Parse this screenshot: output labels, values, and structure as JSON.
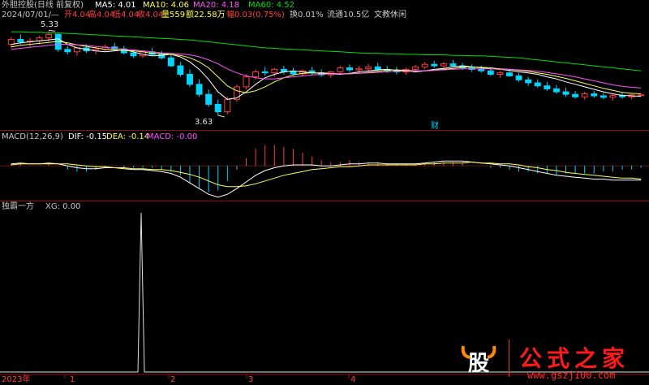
{
  "header": {
    "title": "外胆控股(日线 前复权)",
    "ma5_label": "MA5: 4.01",
    "ma10_label": "MA10: 4.06",
    "ma20_label": "MA20: 4.18",
    "ma60_label": "MA60: 4.52",
    "date": "2024/07/01/—",
    "open": "开4.04",
    "high": "高4.04",
    "low": "低4.04",
    "close": "收4.04",
    "volume": "量559",
    "amount": "额22.58万",
    "change": "幅0.03(0.75%)",
    "turnover": "换0.01%",
    "float": "流通10.5亿",
    "industry": "文教休闲"
  },
  "price_annotations": {
    "high": "5.33",
    "low": "3.63",
    "marker": "财"
  },
  "macd_header": {
    "name": "MACD(12,26,9)",
    "dif": "DIF: -0.15",
    "dea": "DEA: -0.14",
    "macd": "MACD: -0.00"
  },
  "xg_header": {
    "name": "独霸一方",
    "xg": "XG: 0.00"
  },
  "x_axis": {
    "labels": [
      "2023年",
      "1",
      "2",
      "3",
      "4"
    ]
  },
  "watermark": {
    "brand": "公式之家",
    "url": "www.gszj100.com",
    "logo_char": "股"
  },
  "colors": {
    "up": "#ff3c3c",
    "down": "#00d4ff",
    "ma5": "#ffffff",
    "ma10": "#ffff54",
    "ma20": "#ff54ff",
    "ma60": "#00e000",
    "dif": "#ffffff",
    "dea": "#ffff54"
  },
  "chart_data": [
    {
      "type": "candlestick",
      "title": "外胆控股(日线 前复权)",
      "ylim": [
        3.5,
        5.45
      ],
      "annotations": [
        {
          "label": "5.33",
          "value": 5.33
        },
        {
          "label": "3.63",
          "value": 3.63
        }
      ],
      "series": [
        {
          "name": "MA5",
          "values": [
            5.05,
            5.08,
            5.1,
            5.12,
            5.14,
            5.16,
            5.05,
            4.98,
            4.95,
            4.92,
            4.9,
            4.92,
            4.94,
            4.9,
            4.85,
            4.82,
            4.83,
            4.85,
            4.8,
            4.7,
            4.55,
            4.35,
            4.1,
            3.95,
            3.98,
            4.1,
            4.25,
            4.38,
            4.45,
            4.5,
            4.52,
            4.5,
            4.48,
            4.47,
            4.46,
            4.45,
            4.47,
            4.5,
            4.52,
            4.54,
            4.55,
            4.53,
            4.52,
            4.5,
            4.52,
            4.55,
            4.57,
            4.6,
            4.62,
            4.6,
            4.58,
            4.56,
            4.55,
            4.53,
            4.5,
            4.48,
            4.45,
            4.4,
            4.36,
            4.3,
            4.25,
            4.2,
            4.15,
            4.1,
            4.06,
            4.03,
            4.02,
            4.01
          ]
        },
        {
          "name": "MA10",
          "values": [
            5.0,
            5.03,
            5.05,
            5.07,
            5.09,
            5.11,
            5.08,
            5.04,
            5.01,
            4.98,
            4.95,
            4.94,
            4.93,
            4.92,
            4.9,
            4.87,
            4.86,
            4.85,
            4.83,
            4.78,
            4.7,
            4.58,
            4.4,
            4.22,
            4.12,
            4.08,
            4.12,
            4.2,
            4.3,
            4.38,
            4.44,
            4.47,
            4.48,
            4.48,
            4.47,
            4.46,
            4.46,
            4.47,
            4.49,
            4.51,
            4.53,
            4.54,
            4.53,
            4.52,
            4.52,
            4.53,
            4.55,
            4.57,
            4.59,
            4.6,
            4.59,
            4.58,
            4.56,
            4.55,
            4.53,
            4.51,
            4.48,
            4.45,
            4.41,
            4.37,
            4.32,
            4.27,
            4.22,
            4.17,
            4.13,
            4.09,
            4.07,
            4.06
          ]
        },
        {
          "name": "MA20",
          "values": [
            4.95,
            4.97,
            4.99,
            5.01,
            5.03,
            5.05,
            5.05,
            5.04,
            5.03,
            5.01,
            4.99,
            4.97,
            4.95,
            4.94,
            4.92,
            4.9,
            4.88,
            4.87,
            4.86,
            4.84,
            4.8,
            4.74,
            4.66,
            4.56,
            4.48,
            4.42,
            4.38,
            4.36,
            4.36,
            4.38,
            4.4,
            4.42,
            4.44,
            4.45,
            4.46,
            4.46,
            4.47,
            4.47,
            4.48,
            4.49,
            4.5,
            4.51,
            4.51,
            4.52,
            4.52,
            4.53,
            4.54,
            4.55,
            4.56,
            4.56,
            4.56,
            4.56,
            4.55,
            4.55,
            4.54,
            4.53,
            4.51,
            4.49,
            4.46,
            4.43,
            4.4,
            4.36,
            4.32,
            4.28,
            4.24,
            4.21,
            4.19,
            4.18
          ]
        },
        {
          "name": "MA60",
          "values": [
            5.3,
            5.3,
            5.29,
            5.29,
            5.28,
            5.28,
            5.27,
            5.26,
            5.25,
            5.24,
            5.23,
            5.22,
            5.21,
            5.2,
            5.19,
            5.18,
            5.17,
            5.16,
            5.15,
            5.14,
            5.12,
            5.1,
            5.08,
            5.06,
            5.04,
            5.02,
            5.0,
            4.98,
            4.97,
            4.96,
            4.95,
            4.94,
            4.93,
            4.92,
            4.91,
            4.9,
            4.89,
            4.88,
            4.87,
            4.87,
            4.86,
            4.86,
            4.85,
            4.85,
            4.84,
            4.84,
            4.84,
            4.83,
            4.83,
            4.82,
            4.82,
            4.81,
            4.8,
            4.79,
            4.78,
            4.76,
            4.74,
            4.72,
            4.7,
            4.68,
            4.66,
            4.64,
            4.62,
            4.6,
            4.58,
            4.56,
            4.54,
            4.52
          ]
        }
      ],
      "candles": [
        [
          5.05,
          5.2,
          4.98,
          5.15
        ],
        [
          5.15,
          5.25,
          5.05,
          5.1
        ],
        [
          5.1,
          5.18,
          5.0,
          5.12
        ],
        [
          5.12,
          5.22,
          5.05,
          5.18
        ],
        [
          5.18,
          5.33,
          5.1,
          5.25
        ],
        [
          5.25,
          5.28,
          4.9,
          4.95
        ],
        [
          4.95,
          5.02,
          4.85,
          4.9
        ],
        [
          4.9,
          5.0,
          4.82,
          4.98
        ],
        [
          4.98,
          5.05,
          4.88,
          4.92
        ],
        [
          4.92,
          5.0,
          4.85,
          4.95
        ],
        [
          4.95,
          5.05,
          4.9,
          5.0
        ],
        [
          5.0,
          5.08,
          4.92,
          4.96
        ],
        [
          4.96,
          5.02,
          4.85,
          4.88
        ],
        [
          4.88,
          4.95,
          4.78,
          4.82
        ],
        [
          4.82,
          4.92,
          4.78,
          4.9
        ],
        [
          4.9,
          4.98,
          4.82,
          4.85
        ],
        [
          4.85,
          4.92,
          4.75,
          4.78
        ],
        [
          4.78,
          4.85,
          4.6,
          4.62
        ],
        [
          4.62,
          4.7,
          4.4,
          4.45
        ],
        [
          4.45,
          4.55,
          4.2,
          4.25
        ],
        [
          4.25,
          4.35,
          4.0,
          4.05
        ],
        [
          4.05,
          4.15,
          3.8,
          3.85
        ],
        [
          3.85,
          3.95,
          3.63,
          3.7
        ],
        [
          3.7,
          4.0,
          3.65,
          3.95
        ],
        [
          3.95,
          4.25,
          3.9,
          4.2
        ],
        [
          4.2,
          4.45,
          4.15,
          4.4
        ],
        [
          4.4,
          4.55,
          4.35,
          4.5
        ],
        [
          4.5,
          4.6,
          4.42,
          4.48
        ],
        [
          4.48,
          4.58,
          4.4,
          4.55
        ],
        [
          4.55,
          4.62,
          4.45,
          4.5
        ],
        [
          4.5,
          4.58,
          4.42,
          4.46
        ],
        [
          4.46,
          4.55,
          4.4,
          4.52
        ],
        [
          4.52,
          4.6,
          4.44,
          4.48
        ],
        [
          4.48,
          4.55,
          4.4,
          4.44
        ],
        [
          4.44,
          4.52,
          4.38,
          4.5
        ],
        [
          4.5,
          4.62,
          4.45,
          4.58
        ],
        [
          4.58,
          4.65,
          4.5,
          4.54
        ],
        [
          4.54,
          4.62,
          4.48,
          4.56
        ],
        [
          4.56,
          4.66,
          4.5,
          4.6
        ],
        [
          4.6,
          4.68,
          4.52,
          4.55
        ],
        [
          4.55,
          4.62,
          4.48,
          4.52
        ],
        [
          4.52,
          4.6,
          4.45,
          4.5
        ],
        [
          4.5,
          4.58,
          4.44,
          4.55
        ],
        [
          4.55,
          4.64,
          4.5,
          4.6
        ],
        [
          4.6,
          4.7,
          4.55,
          4.65
        ],
        [
          4.65,
          4.72,
          4.58,
          4.62
        ],
        [
          4.62,
          4.7,
          4.56,
          4.66
        ],
        [
          4.66,
          4.74,
          4.6,
          4.62
        ],
        [
          4.62,
          4.68,
          4.54,
          4.58
        ],
        [
          4.58,
          4.65,
          4.5,
          4.55
        ],
        [
          4.55,
          4.62,
          4.48,
          4.52
        ],
        [
          4.52,
          4.58,
          4.42,
          4.45
        ],
        [
          4.45,
          4.52,
          4.38,
          4.48
        ],
        [
          4.48,
          4.55,
          4.4,
          4.42
        ],
        [
          4.42,
          4.48,
          4.3,
          4.34
        ],
        [
          4.34,
          4.4,
          4.22,
          4.28
        ],
        [
          4.28,
          4.35,
          4.18,
          4.22
        ],
        [
          4.22,
          4.3,
          4.12,
          4.16
        ],
        [
          4.16,
          4.24,
          4.06,
          4.1
        ],
        [
          4.1,
          4.18,
          4.0,
          4.05
        ],
        [
          4.05,
          4.12,
          3.96,
          4.0
        ],
        [
          4.0,
          4.1,
          3.94,
          4.06
        ],
        [
          4.06,
          4.12,
          3.98,
          4.02
        ],
        [
          4.02,
          4.08,
          3.95,
          3.99
        ],
        [
          3.99,
          4.06,
          3.92,
          4.03
        ],
        [
          4.03,
          4.08,
          3.96,
          4.0
        ],
        [
          4.0,
          4.06,
          3.95,
          4.04
        ],
        [
          4.04,
          4.04,
          4.04,
          4.04
        ]
      ]
    },
    {
      "type": "line",
      "title": "MACD(12,26,9)",
      "ylim": [
        -0.35,
        0.25
      ],
      "series": [
        {
          "name": "DIF",
          "values": [
            0.02,
            0.03,
            0.02,
            0.02,
            0.03,
            0.02,
            0.0,
            -0.02,
            -0.03,
            -0.03,
            -0.02,
            -0.02,
            -0.03,
            -0.04,
            -0.04,
            -0.05,
            -0.06,
            -0.08,
            -0.12,
            -0.18,
            -0.24,
            -0.3,
            -0.33,
            -0.3,
            -0.24,
            -0.17,
            -0.1,
            -0.05,
            -0.02,
            0.0,
            0.01,
            0.01,
            0.01,
            0.0,
            0.0,
            0.01,
            0.02,
            0.02,
            0.03,
            0.03,
            0.02,
            0.02,
            0.02,
            0.02,
            0.03,
            0.04,
            0.05,
            0.05,
            0.05,
            0.04,
            0.03,
            0.02,
            0.01,
            0.0,
            -0.02,
            -0.04,
            -0.06,
            -0.08,
            -0.1,
            -0.11,
            -0.12,
            -0.13,
            -0.14,
            -0.14,
            -0.15,
            -0.15,
            -0.15,
            -0.15
          ]
        },
        {
          "name": "DEA",
          "values": [
            0.01,
            0.02,
            0.02,
            0.02,
            0.02,
            0.02,
            0.02,
            0.01,
            0.0,
            -0.01,
            -0.01,
            -0.02,
            -0.02,
            -0.03,
            -0.03,
            -0.04,
            -0.04,
            -0.05,
            -0.07,
            -0.09,
            -0.12,
            -0.16,
            -0.2,
            -0.22,
            -0.22,
            -0.21,
            -0.19,
            -0.16,
            -0.13,
            -0.1,
            -0.08,
            -0.06,
            -0.04,
            -0.03,
            -0.02,
            -0.01,
            -0.01,
            0.0,
            0.01,
            0.01,
            0.01,
            0.01,
            0.01,
            0.01,
            0.02,
            0.02,
            0.03,
            0.03,
            0.03,
            0.04,
            0.03,
            0.03,
            0.02,
            0.02,
            0.01,
            -0.01,
            -0.02,
            -0.04,
            -0.05,
            -0.07,
            -0.08,
            -0.09,
            -0.1,
            -0.11,
            -0.12,
            -0.13,
            -0.13,
            -0.14
          ]
        }
      ]
    },
    {
      "type": "line",
      "title": "独霸一方",
      "ylim": [
        0,
        1
      ],
      "series": [
        {
          "name": "XG",
          "values": [
            0,
            0,
            0,
            0,
            0,
            0,
            0,
            0,
            0,
            0,
            0,
            0,
            0,
            0,
            0,
            0,
            0,
            0,
            0,
            0,
            0,
            0,
            0,
            0,
            0,
            0,
            0,
            0,
            0,
            0,
            0,
            0,
            0,
            0,
            0,
            0,
            0,
            0,
            0,
            0,
            0,
            0,
            0,
            0,
            0,
            0,
            0,
            0,
            0,
            0,
            0,
            0,
            0,
            0,
            0,
            0,
            0,
            0,
            0,
            0,
            0,
            0,
            0,
            0,
            0,
            0,
            0,
            0
          ]
        },
        {
          "name": "XG-signal",
          "values": [
            [
              174,
              1
            ]
          ]
        }
      ]
    }
  ]
}
